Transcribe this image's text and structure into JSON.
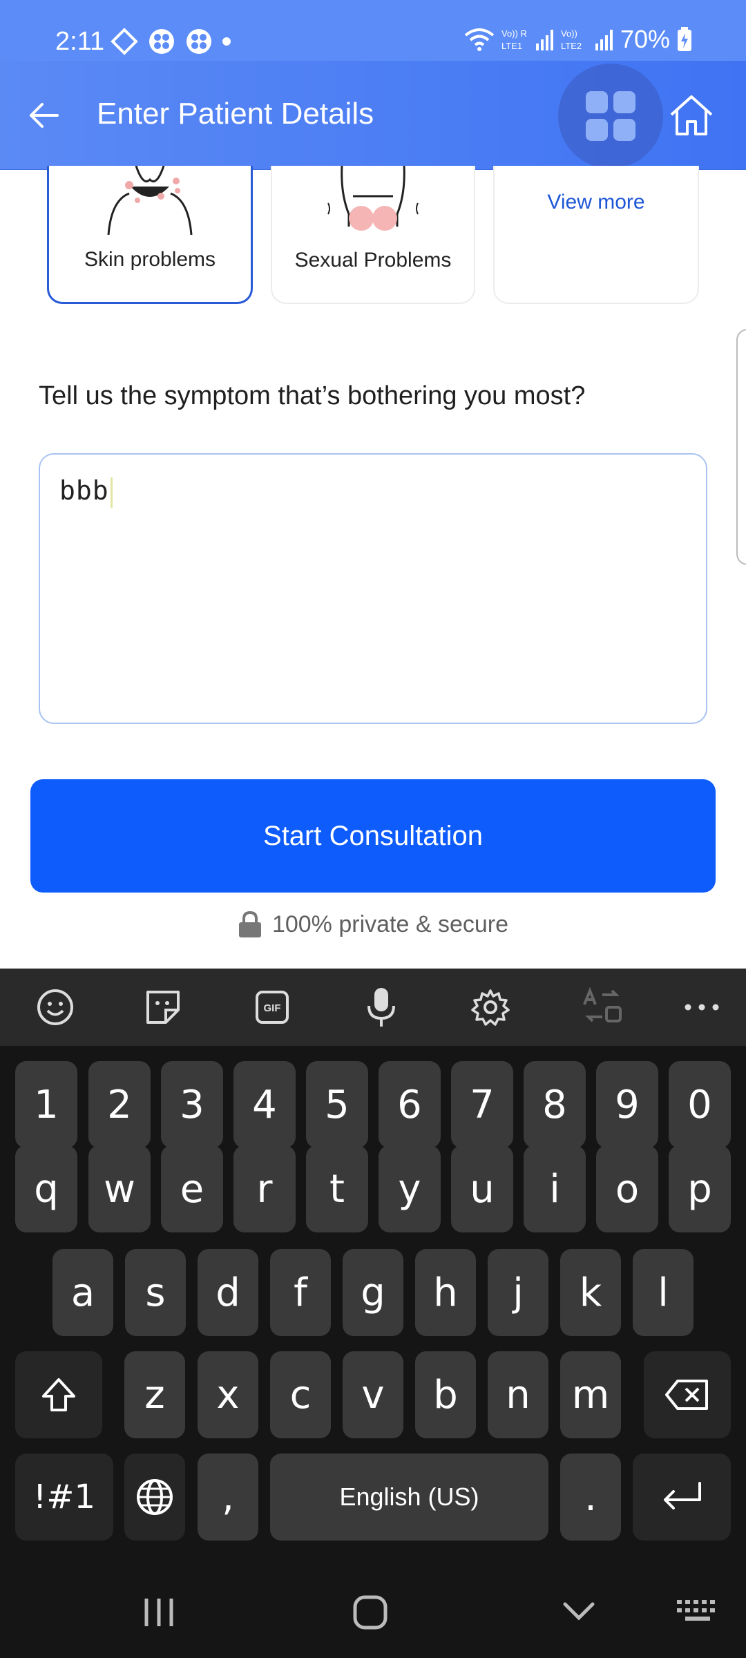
{
  "status": {
    "time": "2:11",
    "battery": "70%"
  },
  "appbar": {
    "title": "Enter Patient Details"
  },
  "categories": [
    {
      "label": "Skin problems",
      "selected": true
    },
    {
      "label": "Sexual Problems",
      "selected": false
    },
    {
      "label": "View more",
      "selected": false
    }
  ],
  "form": {
    "question": "Tell us the symptom that’s bothering you most?",
    "symptom_value": "bbb"
  },
  "cta": {
    "start_label": "Start Consultation",
    "secure_text": "100% private & secure"
  },
  "keyboard": {
    "row_numbers": [
      "1",
      "2",
      "3",
      "4",
      "5",
      "6",
      "7",
      "8",
      "9",
      "0"
    ],
    "row_q": [
      "q",
      "w",
      "e",
      "r",
      "t",
      "y",
      "u",
      "i",
      "o",
      "p"
    ],
    "row_a": [
      "a",
      "s",
      "d",
      "f",
      "g",
      "h",
      "j",
      "k",
      "l"
    ],
    "row_z": [
      "z",
      "x",
      "c",
      "v",
      "b",
      "n",
      "m"
    ],
    "symbols": "!#1",
    "comma": ",",
    "space": "English (US)",
    "period": "."
  },
  "colors": {
    "primary": "#0d5cfb",
    "appbar": "#4a7cf4",
    "keyboard_bg": "#151515",
    "key_bg": "#3a3a3a"
  }
}
